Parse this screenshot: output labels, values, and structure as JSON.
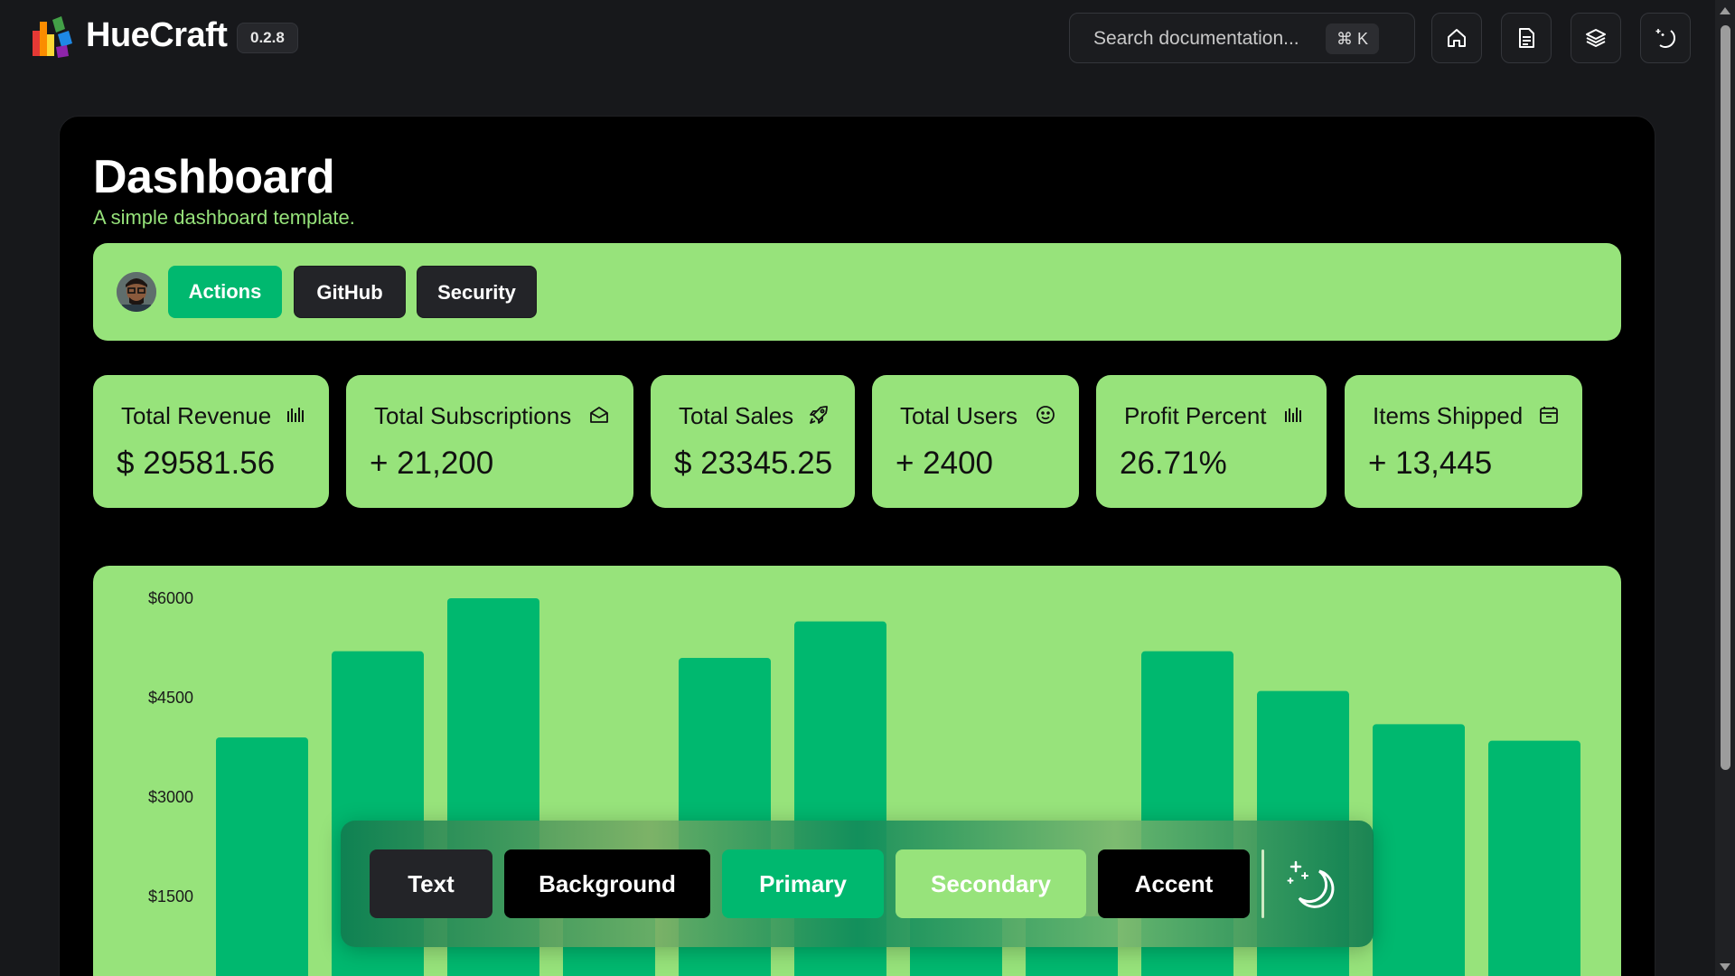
{
  "app": {
    "brand": "HueCraft",
    "version": "0.2.8"
  },
  "search": {
    "placeholder": "Search documentation...",
    "shortcut": "⌘ K"
  },
  "header_icons": [
    "home-icon",
    "document-icon",
    "layers-icon",
    "theme-toggle-icon"
  ],
  "page": {
    "title": "Dashboard",
    "subtitle": "A simple dashboard template."
  },
  "actions": {
    "primary": "Actions",
    "github": "GitHub",
    "security": "Security"
  },
  "stats": [
    {
      "title": "Total Revenue",
      "value": "$ 29581.56",
      "icon": "bar-chart-icon"
    },
    {
      "title": "Total Subscriptions",
      "value": "+ 21,200",
      "icon": "mail-icon"
    },
    {
      "title": "Total Sales",
      "value": "$ 23345.25",
      "icon": "rocket-icon"
    },
    {
      "title": "Total Users",
      "value": "+ 2400",
      "icon": "smile-icon"
    },
    {
      "title": "Profit Percent",
      "value": "26.71%",
      "icon": "bar-chart-icon"
    },
    {
      "title": "Items Shipped",
      "value": "+ 13,445",
      "icon": "package-icon"
    }
  ],
  "palette": {
    "text": "Text",
    "background": "Background",
    "primary": "Primary",
    "secondary": "Secondary",
    "accent": "Accent"
  },
  "colors": {
    "primary": "#00b86f",
    "secondary": "#97e37b",
    "background": "#000000",
    "text": "#232428"
  },
  "chart_data": {
    "type": "bar",
    "y_tick_labels": [
      "$6000",
      "$4500",
      "$3000",
      "$1500"
    ],
    "ylim": [
      0,
      6000
    ],
    "values": [
      3900,
      5200,
      6000,
      1200,
      5100,
      5650,
      1200,
      1200,
      5200,
      4600,
      4100,
      3850
    ],
    "grid": false,
    "note": "bottom of chart cut off by viewport"
  }
}
